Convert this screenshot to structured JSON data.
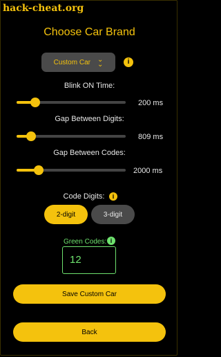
{
  "watermark": "hack-cheat.org",
  "title": "Choose Car Brand",
  "brand": {
    "selected": "Custom Car",
    "icon": "chevrons-down-icon",
    "info_icon": "i"
  },
  "sliders": [
    {
      "label": "Blink ON Time:",
      "value_text": "200 ms",
      "fraction": 0.17
    },
    {
      "label": "Gap Between Digits:",
      "value_text": "809 ms",
      "fraction": 0.13
    },
    {
      "label": "Gap Between Codes:",
      "value_text": "2000 ms",
      "fraction": 0.2
    }
  ],
  "code_digits": {
    "label": "Code Digits:",
    "info_icon": "i",
    "options": [
      "2-digit",
      "3-digit"
    ],
    "selected": "2-digit"
  },
  "green_codes": {
    "label": "Green Codes:",
    "info_icon": "i",
    "value": "12"
  },
  "buttons": {
    "save": "Save Custom Car",
    "back": "Back"
  },
  "colors": {
    "accent": "#f4c20d",
    "green": "#6ee26e",
    "background": "#000000",
    "control": "#4a4a4a"
  }
}
